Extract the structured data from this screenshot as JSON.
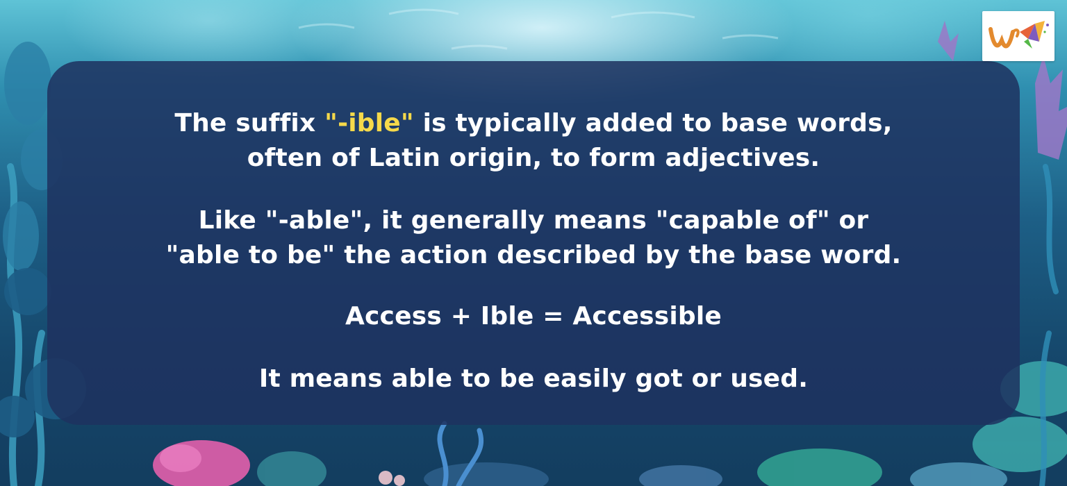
{
  "content": {
    "paragraph1": {
      "line1_before": "The suffix ",
      "highlight": "\"-ible\"",
      "line1_after": " is typically added to base words,",
      "line2": "often of Latin origin, to form adjectives."
    },
    "paragraph2": {
      "line1": "Like \"-able\", it generally means \"capable of\" or",
      "line2": "\"able to be\" the action described by the base word."
    },
    "example": "Access + Ible = Accessible",
    "meaning": "It means able to be easily got or used."
  },
  "colors": {
    "highlight": "#f6d94a",
    "text": "#ffffff",
    "panel": "#1e325f"
  },
  "icons": {
    "logo": "w-logo-icon"
  }
}
